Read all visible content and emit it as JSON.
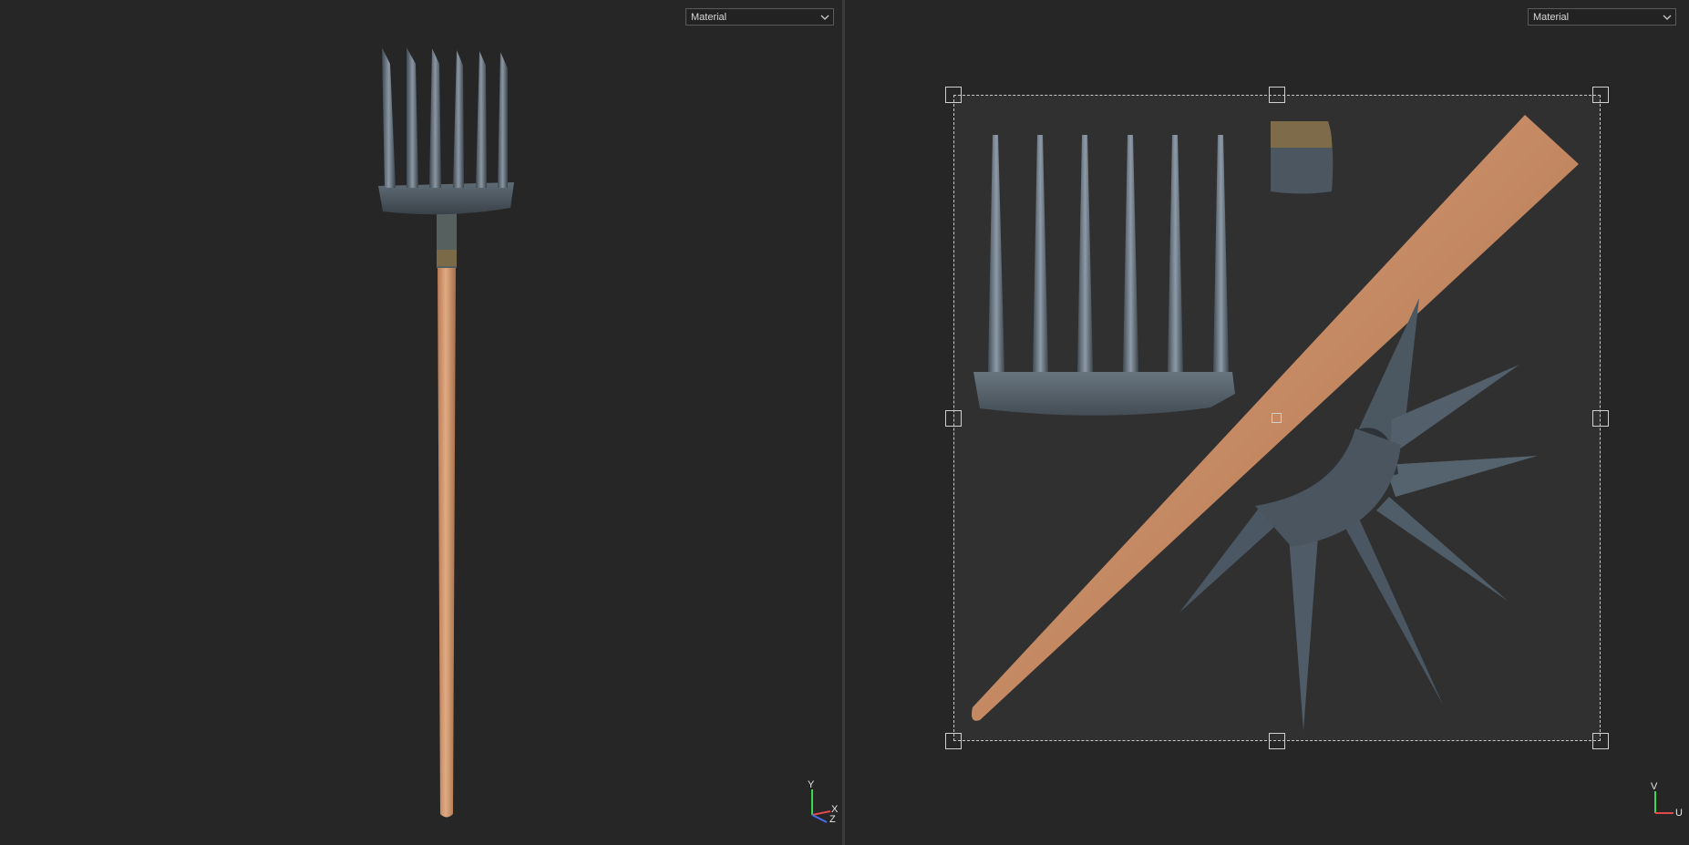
{
  "viewport_3d": {
    "material_select": {
      "selected": "Material"
    },
    "gizmo": {
      "y": "Y",
      "x": "X",
      "z": "Z"
    }
  },
  "viewport_uv": {
    "material_select": {
      "selected": "Material"
    },
    "gizmo": {
      "v": "V",
      "u": "U"
    }
  },
  "colors": {
    "viewport_bg": "#262626",
    "uv_sheet_bg": "#303030",
    "wood": "#d29a70",
    "metal": "#4f5a63"
  },
  "icons": [
    "chevron-down-icon",
    "axis-gizmo-icon",
    "uv-axis-gizmo-icon"
  ]
}
